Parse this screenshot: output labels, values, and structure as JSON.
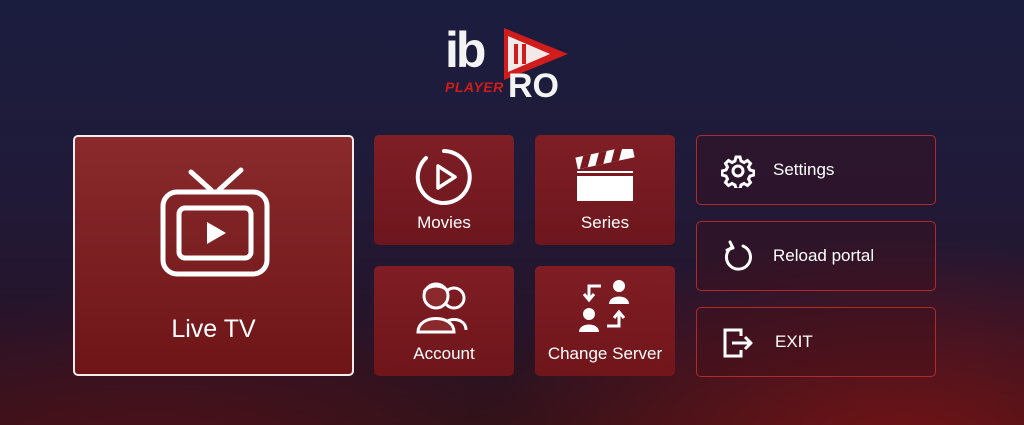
{
  "logo": {
    "ib": "ib",
    "player": "PLAYER",
    "pro": "RO"
  },
  "tiles": {
    "live_tv": {
      "label": "Live TV",
      "icon": "tv-play-icon"
    },
    "movies": {
      "label": "Movies",
      "icon": "play-circle-icon"
    },
    "series": {
      "label": "Series",
      "icon": "clapperboard-icon"
    },
    "account": {
      "label": "Account",
      "icon": "users-icon"
    },
    "change_server": {
      "label": "Change Server",
      "icon": "swap-users-icon"
    }
  },
  "side_menu": [
    {
      "label": "Settings",
      "icon": "gear-icon"
    },
    {
      "label": "Reload portal",
      "icon": "reload-icon"
    },
    {
      "label": "EXIT",
      "icon": "exit-icon"
    }
  ],
  "colors": {
    "accent": "#d11c1c",
    "tile": "#8a2a2c",
    "background": "#1b1d3f"
  }
}
